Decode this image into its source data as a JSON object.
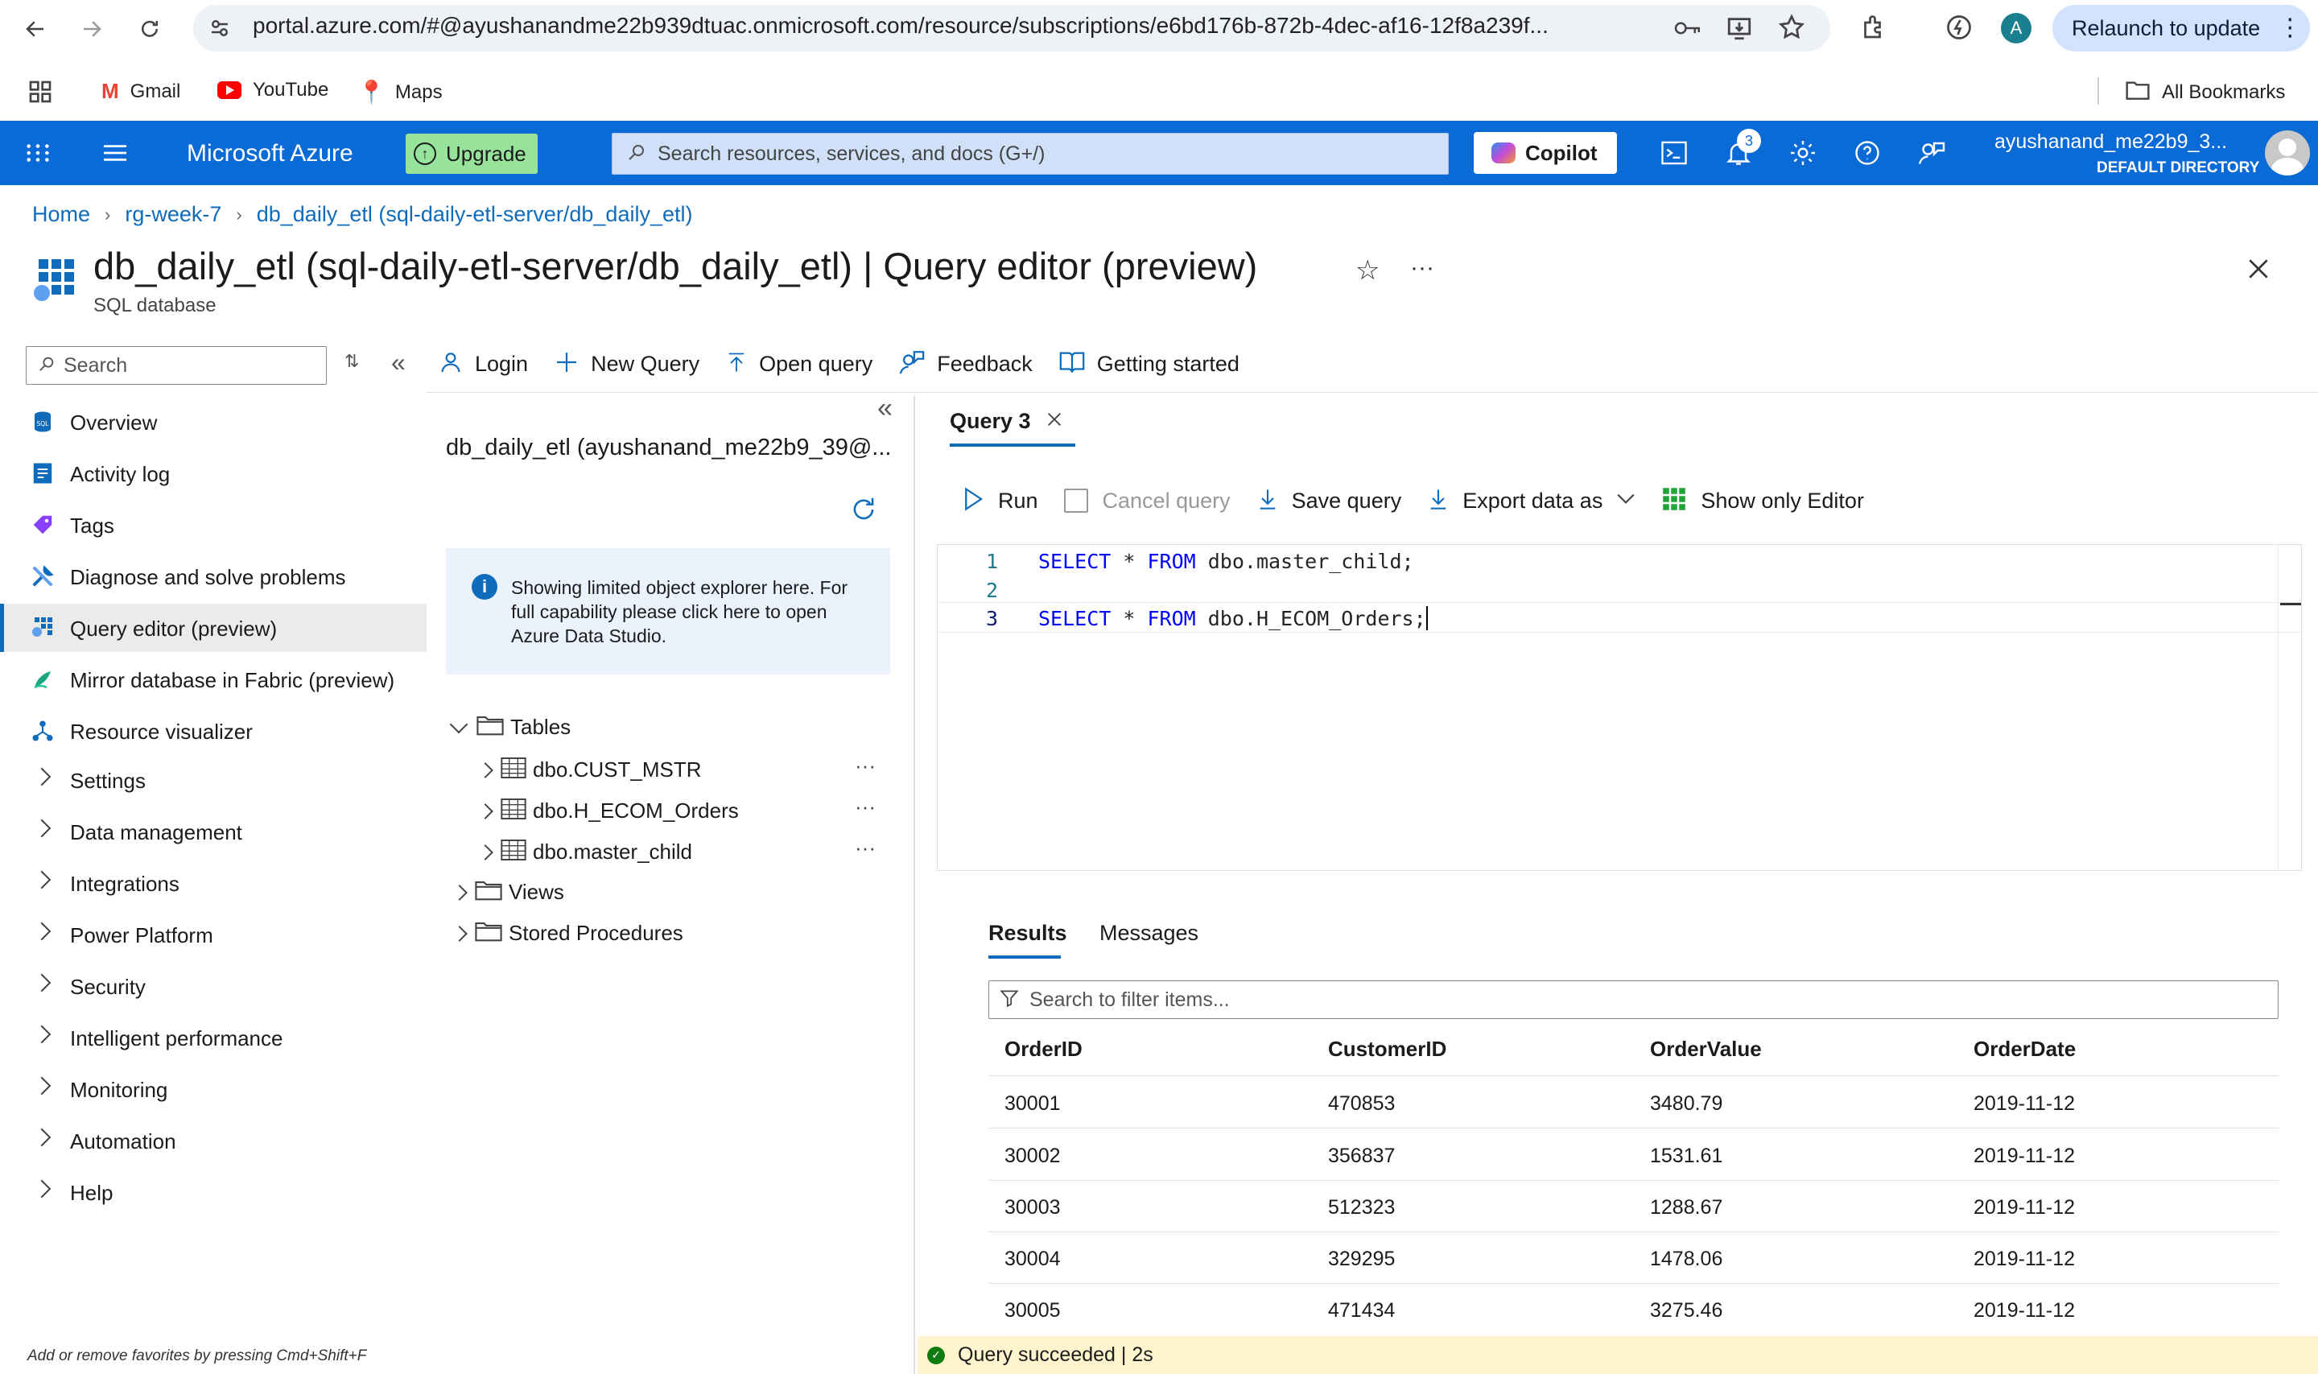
{
  "browser": {
    "url": "portal.azure.com/#@ayushanandme22b939dtuac.onmicrosoft.com/resource/subscriptions/e6bd176b-872b-4dec-af16-12f8a239f...",
    "relaunch_label": "Relaunch to update",
    "profile_initial": "A",
    "bookmarks": [
      "Gmail",
      "YouTube",
      "Maps"
    ],
    "all_bookmarks": "All Bookmarks"
  },
  "azure": {
    "brand": "Microsoft Azure",
    "upgrade": "Upgrade",
    "search_placeholder": "Search resources, services, and docs (G+/)",
    "copilot": "Copilot",
    "notification_count": "3",
    "user_name": "ayushanand_me22b9_3...",
    "user_directory": "DEFAULT DIRECTORY"
  },
  "breadcrumb": [
    "Home",
    "rg-week-7",
    "db_daily_etl (sql-daily-etl-server/db_daily_etl)"
  ],
  "page": {
    "title": "db_daily_etl (sql-daily-etl-server/db_daily_etl) | Query editor (preview)",
    "subtitle": "SQL database"
  },
  "nav": {
    "search_placeholder": "Search",
    "items": [
      {
        "label": "Overview"
      },
      {
        "label": "Activity log"
      },
      {
        "label": "Tags"
      },
      {
        "label": "Diagnose and solve problems"
      },
      {
        "label": "Query editor (preview)"
      },
      {
        "label": "Mirror database in Fabric (preview)"
      },
      {
        "label": "Resource visualizer"
      }
    ],
    "groups": [
      "Settings",
      "Data management",
      "Integrations",
      "Power Platform",
      "Security",
      "Intelligent performance",
      "Monitoring",
      "Automation",
      "Help"
    ],
    "footer": "Add or remove favorites by pressing Cmd+Shift+F"
  },
  "toolbar": {
    "login": "Login",
    "new_query": "New Query",
    "open_query": "Open query",
    "feedback": "Feedback",
    "getting_started": "Getting started"
  },
  "explorer": {
    "title": "db_daily_etl (ayushanand_me22b9_39@...",
    "info": "Showing limited object explorer here. For full capability please click here to open Azure Data Studio.",
    "tables_label": "Tables",
    "tables": [
      "dbo.CUST_MSTR",
      "dbo.H_ECOM_Orders",
      "dbo.master_child"
    ],
    "views_label": "Views",
    "procs_label": "Stored Procedures"
  },
  "editor": {
    "tab_label": "Query 3",
    "run": "Run",
    "cancel": "Cancel query",
    "save": "Save query",
    "export": "Export data as",
    "show_only": "Show only Editor",
    "lines": [
      {
        "num": "1",
        "kw": "SELECT",
        "op": " * ",
        "kw2": "FROM",
        "rest": " dbo.master_child;"
      },
      {
        "num": "2",
        "kw": "",
        "op": "",
        "kw2": "",
        "rest": ""
      },
      {
        "num": "3",
        "kw": "SELECT",
        "op": " * ",
        "kw2": "FROM",
        "rest": " dbo.H_ECOM_Orders;"
      }
    ]
  },
  "results": {
    "tab_results": "Results",
    "tab_messages": "Messages",
    "filter_placeholder": "Search to filter items...",
    "columns": [
      "OrderID",
      "CustomerID",
      "OrderValue",
      "OrderDate"
    ],
    "rows": [
      [
        "30001",
        "470853",
        "3480.79",
        "2019-11-12"
      ],
      [
        "30002",
        "356837",
        "1531.61",
        "2019-11-12"
      ],
      [
        "30003",
        "512323",
        "1288.67",
        "2019-11-12"
      ],
      [
        "30004",
        "329295",
        "1478.06",
        "2019-11-12"
      ],
      [
        "30005",
        "471434",
        "3275.46",
        "2019-11-12"
      ]
    ],
    "status": "Query succeeded | 2s"
  }
}
